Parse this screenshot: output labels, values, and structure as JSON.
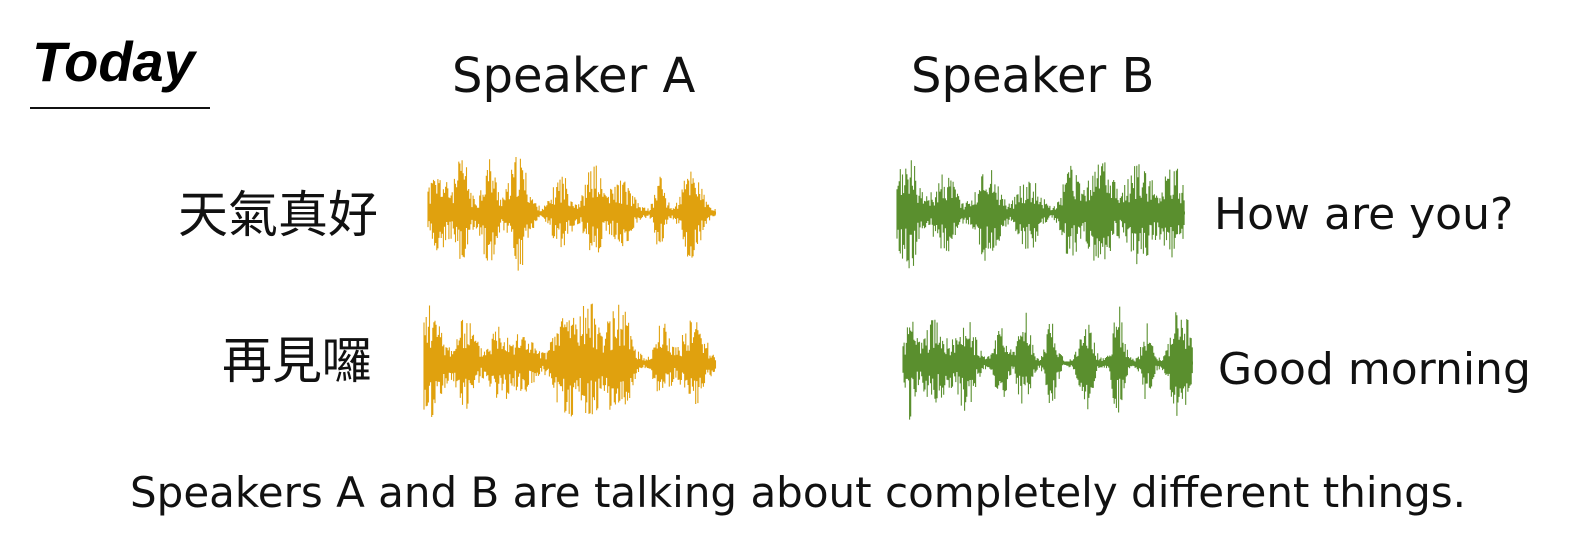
{
  "title": "Today",
  "speaker_a": {
    "label": "Speaker A",
    "color": "#E0A10E",
    "utterances": [
      "天氣真好",
      "再見囉"
    ]
  },
  "speaker_b": {
    "label": "Speaker B",
    "color": "#5A8F2E",
    "utterances": [
      "How are you?",
      "Good morning"
    ]
  },
  "caption": "Speakers A and B are talking about completely different things."
}
